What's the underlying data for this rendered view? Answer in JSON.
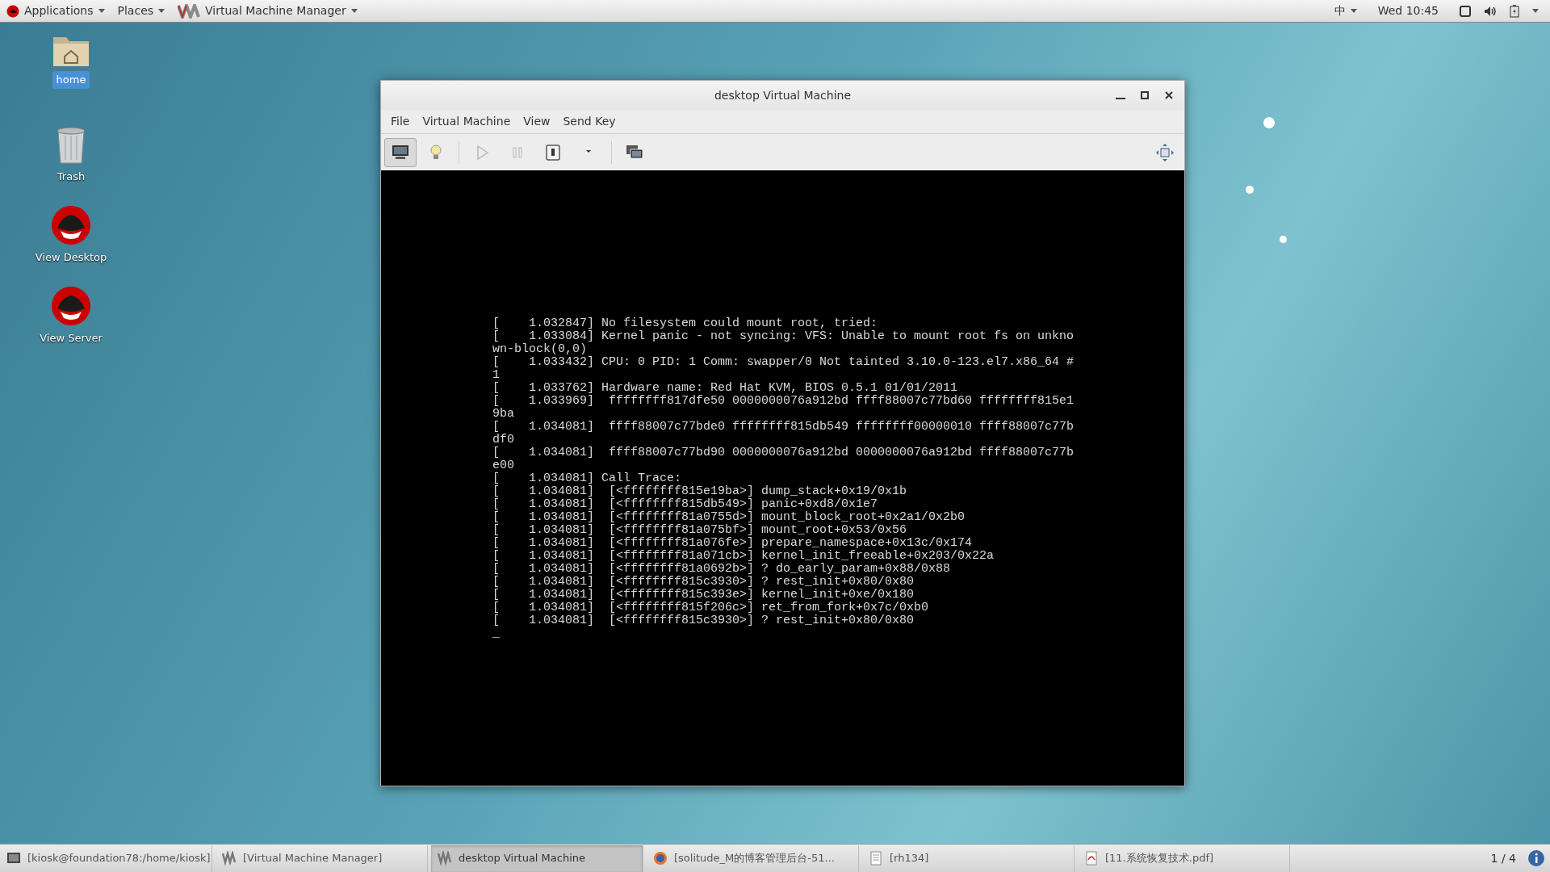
{
  "top_bar": {
    "menus": [
      {
        "label": "Applications",
        "kind": "redhat"
      },
      {
        "label": "Places",
        "kind": "plain"
      },
      {
        "label": "Virtual Machine Manager",
        "kind": "vmm"
      }
    ],
    "input_method": "中",
    "clock": "Wed 10:45"
  },
  "desktop_icons": [
    {
      "label": "home",
      "kind": "folder",
      "selected": true
    },
    {
      "label": "Trash",
      "kind": "trash",
      "selected": false
    },
    {
      "label": "View Desktop",
      "kind": "redhat",
      "selected": false
    },
    {
      "label": "View Server",
      "kind": "redhat",
      "selected": false
    }
  ],
  "window": {
    "title": "desktop Virtual Machine",
    "menu": [
      "File",
      "Virtual Machine",
      "View",
      "Send Key"
    ],
    "toolbar": [
      {
        "kind": "console",
        "selected": true,
        "disabled": false
      },
      {
        "kind": "details",
        "selected": false,
        "disabled": false
      },
      {
        "kind": "run",
        "selected": false,
        "disabled": true
      },
      {
        "kind": "pause",
        "selected": false,
        "disabled": true
      },
      {
        "kind": "power",
        "selected": false,
        "disabled": false
      },
      {
        "kind": "dropdown",
        "selected": false,
        "disabled": false
      },
      {
        "kind": "screenshot",
        "selected": false,
        "disabled": false
      }
    ],
    "console_lines": [
      "[    1.032847] No filesystem could mount root, tried:",
      "[    1.033084] Kernel panic - not syncing: VFS: Unable to mount root fs on unkno",
      "wn-block(0,0)",
      "[    1.033432] CPU: 0 PID: 1 Comm: swapper/0 Not tainted 3.10.0-123.el7.x86_64 #",
      "1",
      "[    1.033762] Hardware name: Red Hat KVM, BIOS 0.5.1 01/01/2011",
      "[    1.033969]  ffffffff817dfe50 0000000076a912bd ffff88007c77bd60 ffffffff815e1",
      "9ba",
      "[    1.034081]  ffff88007c77bde0 ffffffff815db549 ffffffff00000010 ffff88007c77b",
      "df0",
      "[    1.034081]  ffff88007c77bd90 0000000076a912bd 0000000076a912bd ffff88007c77b",
      "e00",
      "[    1.034081] Call Trace:",
      "[    1.034081]  [<ffffffff815e19ba>] dump_stack+0x19/0x1b",
      "[    1.034081]  [<ffffffff815db549>] panic+0xd8/0x1e7",
      "[    1.034081]  [<ffffffff81a0755d>] mount_block_root+0x2a1/0x2b0",
      "[    1.034081]  [<ffffffff81a075bf>] mount_root+0x53/0x56",
      "[    1.034081]  [<ffffffff81a076fe>] prepare_namespace+0x13c/0x174",
      "[    1.034081]  [<ffffffff81a071cb>] kernel_init_freeable+0x203/0x22a",
      "[    1.034081]  [<ffffffff81a0692b>] ? do_early_param+0x88/0x88",
      "[    1.034081]  [<ffffffff815c3930>] ? rest_init+0x80/0x80",
      "[    1.034081]  [<ffffffff815c393e>] kernel_init+0xe/0x180",
      "[    1.034081]  [<ffffffff815f206c>] ret_from_fork+0x7c/0xb0",
      "[    1.034081]  [<ffffffff815c3930>] ? rest_init+0x80/0x80",
      "_"
    ]
  },
  "taskbar": {
    "items": [
      {
        "label": "[kiosk@foundation78:/home/kiosk]",
        "kind": "terminal",
        "selected": false
      },
      {
        "label": "[Virtual Machine Manager]",
        "kind": "vmm",
        "selected": false
      },
      {
        "label": "desktop Virtual Machine",
        "kind": "vmm",
        "selected": true
      },
      {
        "label": "[solitude_M的博客管理后台-51...",
        "kind": "browser",
        "selected": false
      },
      {
        "label": "[rh134]",
        "kind": "document",
        "selected": false
      },
      {
        "label": "[11.系统恢复技术.pdf]",
        "kind": "pdf",
        "selected": false
      }
    ],
    "workspace": "1 / 4"
  }
}
